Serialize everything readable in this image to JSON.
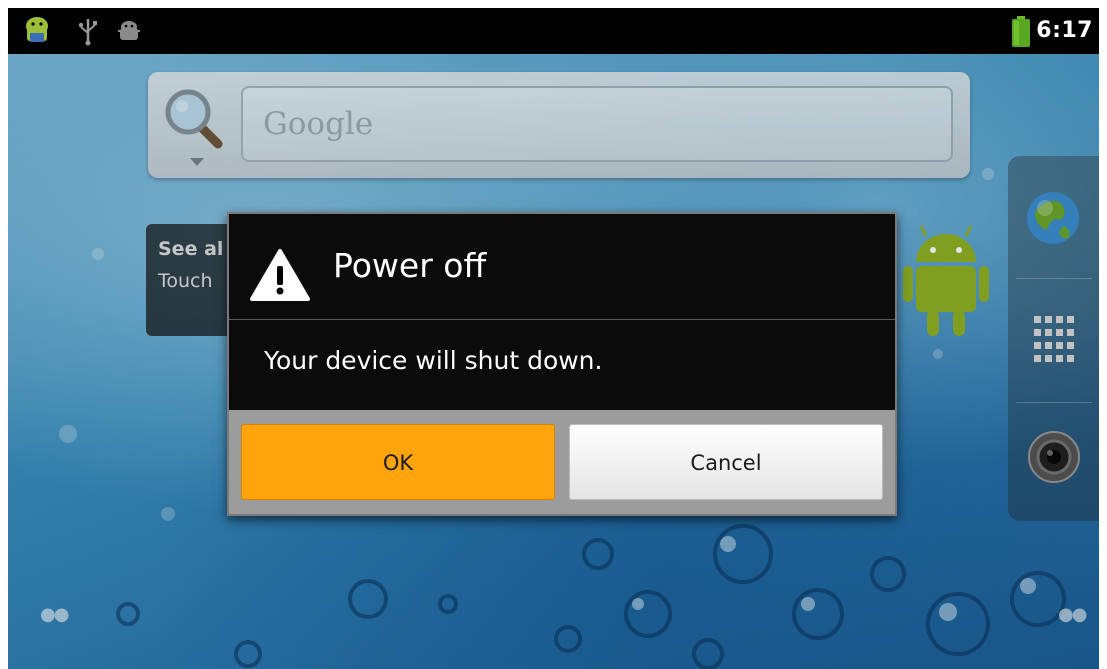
{
  "status_bar": {
    "time": "6:17",
    "icons": [
      "android-notification-icon",
      "usb-icon",
      "debug-icon",
      "battery-icon"
    ]
  },
  "search_widget": {
    "placeholder": "Google",
    "icon": "magnifier-icon"
  },
  "background_tip": {
    "line1": "See al",
    "line2": "Touch"
  },
  "dialog": {
    "title": "Power off",
    "message": "Your device will shut down.",
    "ok_label": "OK",
    "cancel_label": "Cancel",
    "icon": "warning-icon"
  },
  "dock": {
    "items": [
      "browser-icon",
      "app-drawer-icon",
      "camera-icon"
    ]
  },
  "colors": {
    "ok_button": "#ffa40d",
    "dialog_background": "#0b0b0b",
    "status_bar": "#000000"
  }
}
